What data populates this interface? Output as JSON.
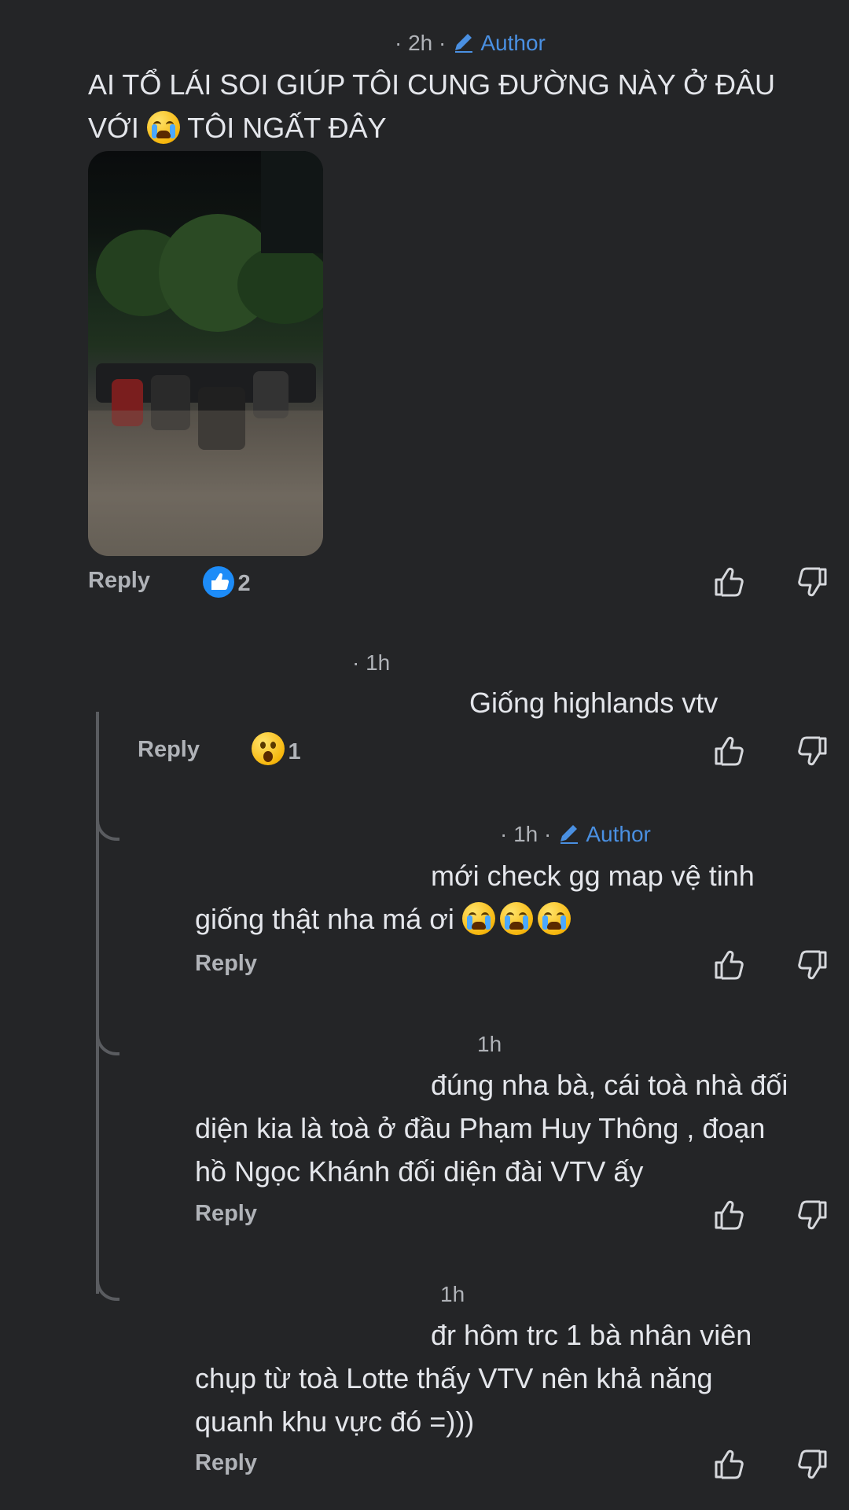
{
  "comments": [
    {
      "time": "· 2h ·",
      "author_label": "Author",
      "text_lines": [
        "AI TỔ LÁI SOI GIÚP TÔI CUNG ĐƯỜNG NÀY Ở ĐÂU",
        "VỚI",
        "TÔI NGẤT ĐÂY"
      ],
      "reply_label": "Reply",
      "reaction_count": "2"
    },
    {
      "time": "· 1h",
      "text_lines": [
        "Giống highlands vtv"
      ],
      "reply_label": "Reply",
      "reaction_count": "1"
    },
    {
      "time": "· 1h ·",
      "author_label": "Author",
      "text_lines": [
        "mới check gg map vệ tinh",
        "giống thật nha má ơi"
      ],
      "reply_label": "Reply"
    },
    {
      "time": "1h",
      "text_lines": [
        "đúng nha bà, cái toà nhà đối",
        "diện kia là toà ở đầu Phạm Huy Thông , đoạn",
        "hồ Ngọc Khánh đối diện đài VTV ấy"
      ],
      "reply_label": "Reply"
    },
    {
      "time": "1h",
      "text_lines": [
        "đr hôm trc 1 bà nhân viên",
        "chụp từ toà Lotte thấy VTV nên khả năng",
        "quanh khu vực đó =)))"
      ],
      "reply_label": "Reply"
    }
  ],
  "icons": [
    "pencil-icon",
    "like-icon",
    "dislike-icon",
    "crying-emoji",
    "wow-emoji",
    "like-reaction-icon"
  ]
}
